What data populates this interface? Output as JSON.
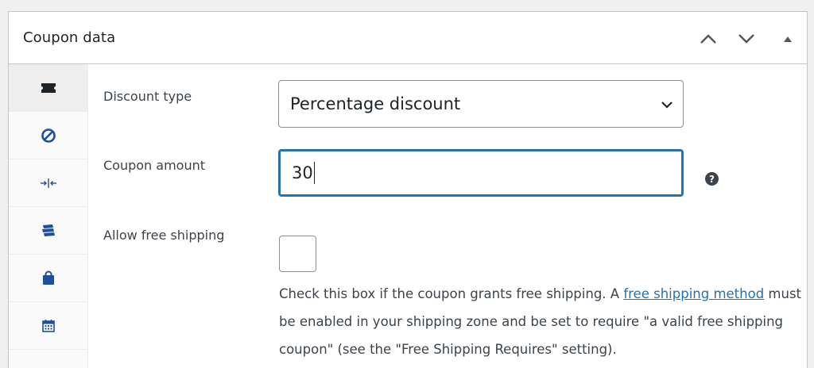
{
  "postbox": {
    "title": "Coupon data",
    "controls": {
      "move_up_icon": "chevron-up-icon",
      "move_down_icon": "chevron-down-icon",
      "toggle_icon": "triangle-up-icon"
    }
  },
  "sidebar": {
    "tabs": [
      {
        "icon": "ticket-icon",
        "active": true
      },
      {
        "icon": "no-entry-icon",
        "active": false
      },
      {
        "icon": "arrows-in-icon",
        "active": false
      },
      {
        "icon": "stacked-tickets-icon",
        "active": false
      },
      {
        "icon": "shopping-bag-icon",
        "active": false
      },
      {
        "icon": "calendar-icon",
        "active": false
      }
    ]
  },
  "form": {
    "discount_type": {
      "label": "Discount type",
      "value": "Percentage discount"
    },
    "coupon_amount": {
      "label": "Coupon amount",
      "value": "30",
      "help_icon": "?"
    },
    "free_shipping": {
      "label": "Allow free shipping",
      "checked": false,
      "description_before": "Check this box if the coupon grants free shipping. A ",
      "description_link": "free shipping method",
      "description_after": " must be enabled in your shipping zone and be set to require \"a valid free shipping coupon\" (see the \"Free Shipping Requires\" setting)."
    }
  },
  "colors": {
    "accent": "#2271b1",
    "border": "#8c8f94",
    "icon": "#1d4f9e"
  }
}
